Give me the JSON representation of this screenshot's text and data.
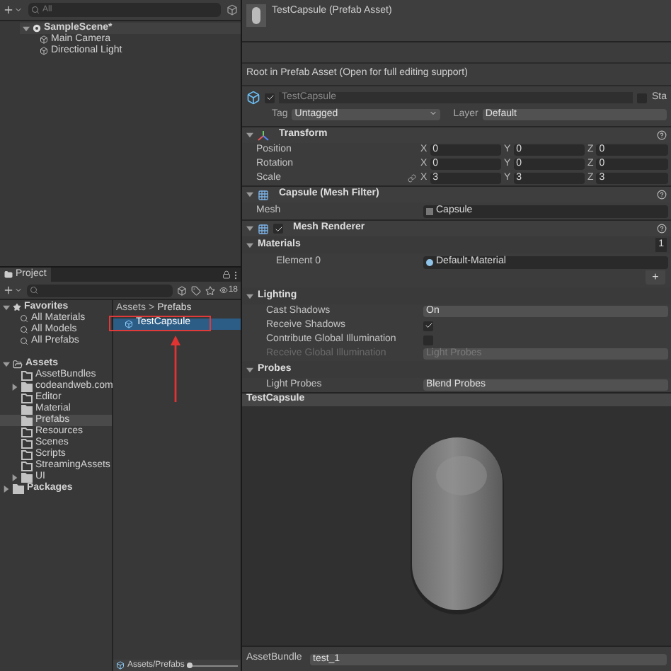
{
  "hierarchy": {
    "search_placeholder": "All",
    "scene": {
      "name": "SampleScene*",
      "expanded": true,
      "children": [
        {
          "name": "Main Camera"
        },
        {
          "name": "Directional Light"
        }
      ]
    }
  },
  "project": {
    "tab": "Project",
    "count": "18",
    "favorites": {
      "label": "Favorites",
      "expanded": true,
      "items": [
        {
          "label": "All Materials"
        },
        {
          "label": "All Models"
        },
        {
          "label": "All Prefabs"
        }
      ]
    },
    "assets": {
      "label": "Assets",
      "expanded": true,
      "children": [
        {
          "label": "AssetBundles",
          "has_children": false,
          "filled": false,
          "selected": false
        },
        {
          "label": "codeandweb.com",
          "has_children": true,
          "filled": true,
          "selected": false
        },
        {
          "label": "Editor",
          "has_children": false,
          "filled": false,
          "selected": false
        },
        {
          "label": "Material",
          "has_children": false,
          "filled": true,
          "selected": false
        },
        {
          "label": "Prefabs",
          "has_children": false,
          "filled": true,
          "selected": true
        },
        {
          "label": "Resources",
          "has_children": false,
          "filled": false,
          "selected": false
        },
        {
          "label": "Scenes",
          "has_children": false,
          "filled": false,
          "selected": false
        },
        {
          "label": "Scripts",
          "has_children": false,
          "filled": false,
          "selected": false
        },
        {
          "label": "StreamingAssets",
          "has_children": false,
          "filled": false,
          "selected": false
        },
        {
          "label": "UI",
          "has_children": true,
          "filled": true,
          "selected": false
        }
      ]
    },
    "packages": {
      "label": "Packages",
      "expanded": false
    },
    "breadcrumb": [
      "Assets",
      "Prefabs"
    ],
    "breadcrumb_separator": ">",
    "files": [
      {
        "name": "TestCapsule",
        "selected": true,
        "highlighted": true
      }
    ],
    "annotation_arrow": true,
    "path": "Assets/Prefabs",
    "zoom_slider": {
      "level": 0.05
    }
  },
  "inspector": {
    "title": "TestCapsule (Prefab Asset)",
    "notice": "Root in Prefab Asset (Open for full editing support)",
    "object": {
      "active": true,
      "static": false,
      "name": "TestCapsule",
      "static_label": "Sta",
      "tag_label": "Tag",
      "tag": "Untagged",
      "layer_label": "Layer",
      "layer": "Default"
    },
    "rows": [
      {
        "kind": "transform",
        "title": "Transform"
      },
      {
        "kind": "vector",
        "label": "Position",
        "values": [
          {
            "axis": "X",
            "value": "0"
          },
          {
            "axis": "Y",
            "value": "0"
          },
          {
            "axis": "Z",
            "value": "0"
          }
        ]
      },
      {
        "kind": "vector",
        "label": "Rotation",
        "values": [
          {
            "axis": "X",
            "value": "0"
          },
          {
            "axis": "Y",
            "value": "0"
          },
          {
            "axis": "Z",
            "value": "0"
          }
        ]
      },
      {
        "kind": "vector",
        "label": "Scale",
        "linked": true,
        "values": [
          {
            "axis": "X",
            "value": "3"
          },
          {
            "axis": "Y",
            "value": "3"
          },
          {
            "axis": "Z",
            "value": "3"
          }
        ]
      },
      {
        "kind": "mesh-filter",
        "title": "Capsule (Mesh Filter)"
      },
      {
        "kind": "object",
        "label": "Mesh",
        "value": "Capsule"
      },
      {
        "kind": "mesh-renderer",
        "title": "Mesh Renderer",
        "enabled": true
      },
      {
        "kind": "foldout",
        "label": "Materials",
        "expanded": true,
        "count": "1"
      },
      {
        "kind": "element",
        "label": "Element 0",
        "value": "Default-Material"
      },
      {
        "kind": "add",
        "label": "+"
      },
      {
        "kind": "foldout",
        "label": "Lighting",
        "expanded": true
      },
      {
        "kind": "dropdown",
        "label": "Cast Shadows",
        "value": "On",
        "disabled": false
      },
      {
        "kind": "checkbox",
        "label": "Receive Shadows",
        "checked": true
      },
      {
        "kind": "checkbox",
        "label": "Contribute Global Illumination",
        "checked": false
      },
      {
        "kind": "dropdown",
        "label": "Receive Global Illumination",
        "value": "Light Probes",
        "disabled": true
      },
      {
        "kind": "foldout",
        "label": "Probes",
        "expanded": true
      },
      {
        "kind": "dropdown",
        "label": "Light Probes",
        "value": "Blend Probes",
        "disabled": false
      }
    ]
  },
  "preview": {
    "title": "TestCapsule",
    "asset_bundle_label": "AssetBundle",
    "asset_bundle": "test_1"
  }
}
